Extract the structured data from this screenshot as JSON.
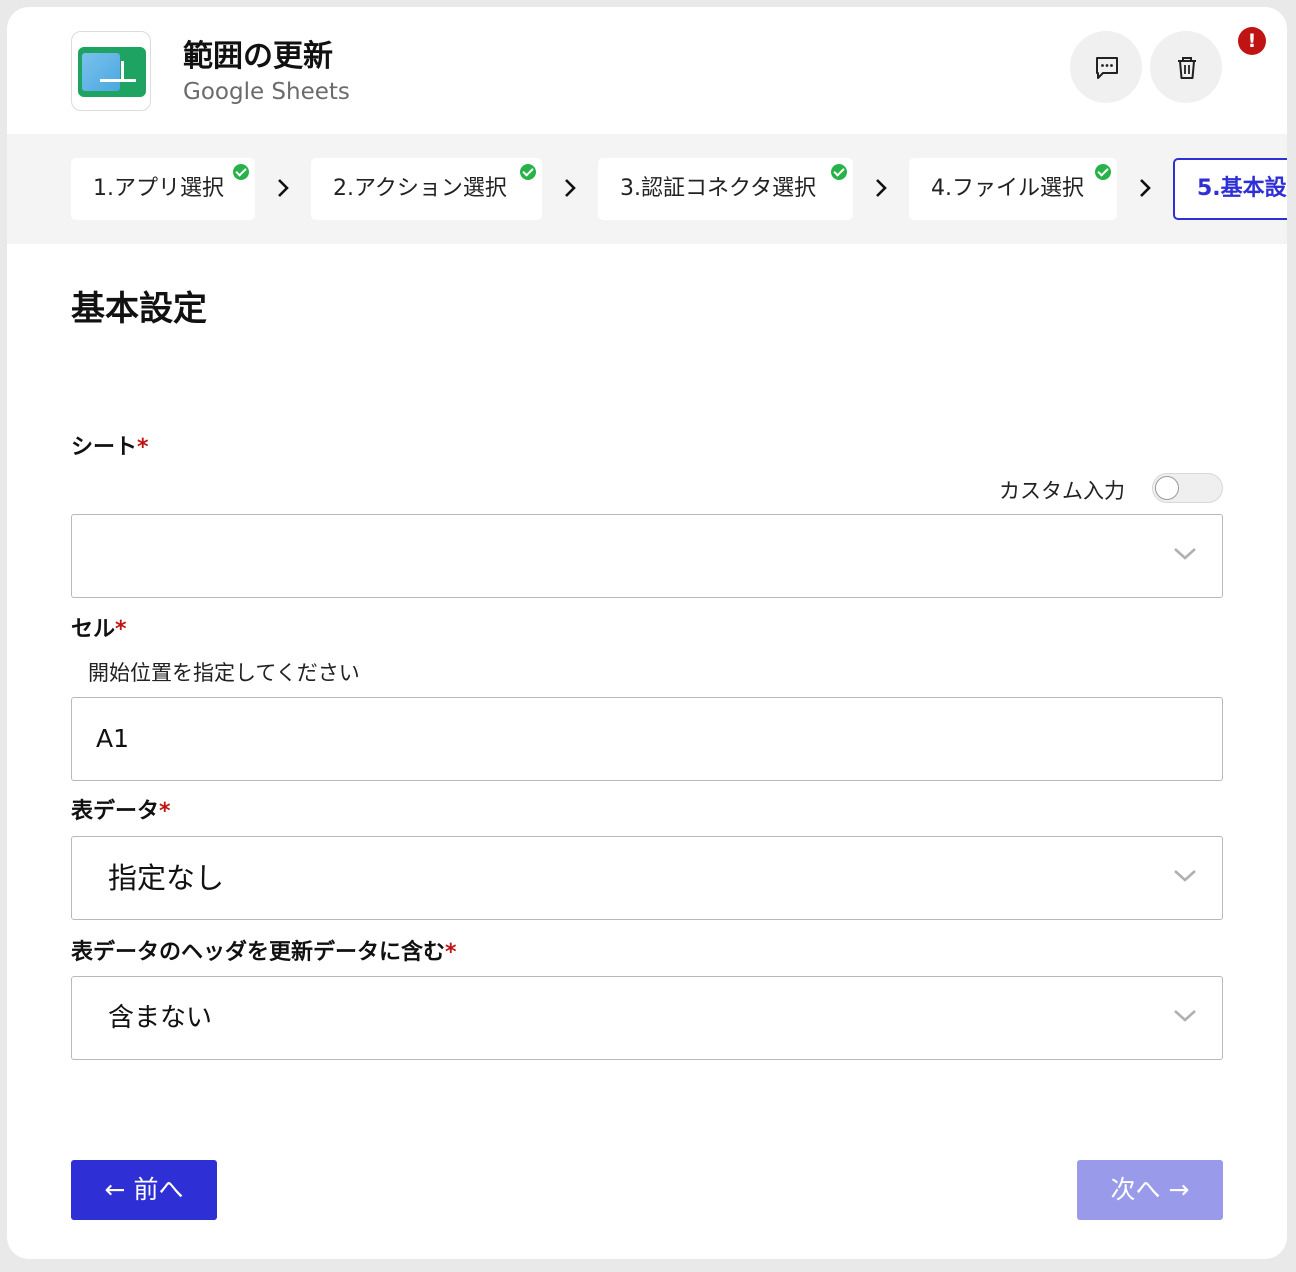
{
  "header": {
    "title": "範囲の更新",
    "subtitle": "Google Sheets",
    "icon": "google-sheets-icon",
    "comment_icon": "comment-icon",
    "trash_icon": "trash-icon",
    "alert_badge": "!"
  },
  "steps": [
    {
      "label": "1.アプリ選択",
      "done": true
    },
    {
      "label": "2.アクション選択",
      "done": true
    },
    {
      "label": "3.認証コネクタ選択",
      "done": true
    },
    {
      "label": "4.ファイル選択",
      "done": true
    },
    {
      "label": "5.基本設",
      "done": false,
      "active": true
    }
  ],
  "main": {
    "section_title": "基本設定",
    "required_mark": "*",
    "sheet": {
      "label": "シート",
      "custom_input_label": "カスタム入力",
      "custom_input_on": false,
      "value": ""
    },
    "cell": {
      "label": "セル",
      "hint": "開始位置を指定してください",
      "value": "A1"
    },
    "table_data": {
      "label": "表データ",
      "value": "指定なし"
    },
    "include_header": {
      "label": "表データのヘッダを更新データに含む",
      "value": "含まない"
    }
  },
  "footer": {
    "prev_label": "← 前へ",
    "next_label": "次へ →"
  },
  "colors": {
    "primary": "#2f2fd6",
    "primary_disabled": "#9a9aeb",
    "required": "#c01414",
    "success": "#27b24a"
  }
}
